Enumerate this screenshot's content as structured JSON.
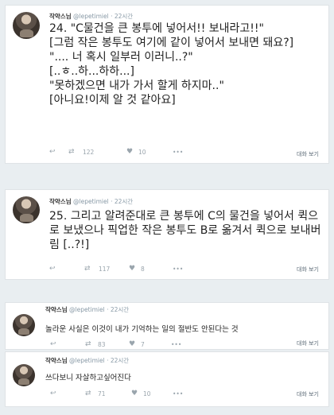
{
  "tweets": [
    {
      "name": "작약스님",
      "handle": "@lepetimiel",
      "time": "· 22시간",
      "lines": [
        "24. \"C물건을 큰 봉투에 넣어서!! 보내라고!!\"",
        "[그럼 작은 봉투도 여기에 같이 넣어서 보내면 돼요?]",
        "\".... 너 혹시 일부러 이러니..?\"",
        "[..ㅎ..하...하하...]",
        "\"못하겠으면 내가 가서 할게 하지마..\"",
        "[아니요!이제 알 것 같아요]"
      ],
      "retweets": "122",
      "likes": "10",
      "conversation": "대화 보기"
    },
    {
      "name": "작약스님",
      "handle": "@lepetimiel",
      "time": "· 22시간",
      "lines": [
        "25. 그리고 알려준대로 큰 봉투에 C의 물건을 넣어서 퀵으로 보냈으나 픽업한 작은 봉투도 B로 옮겨서 퀵으로 보내버림 [..?!]"
      ],
      "retweets": "117",
      "likes": "8",
      "conversation": "대화 보기"
    },
    {
      "name": "작약스님",
      "handle": "@lepetimiel",
      "time": "· 22시간",
      "lines": [
        "놀라운 사실은 이것이 내가 기억하는 일의 절반도 안된다는 것"
      ],
      "retweets": "83",
      "likes": "7",
      "conversation": "대화 보기"
    },
    {
      "name": "작약스님",
      "handle": "@lepetimiel",
      "time": "· 22시간",
      "lines": [
        "쓰다보니 자살하고싶어진다"
      ],
      "retweets": "71",
      "likes": "10",
      "conversation": "대화 보기"
    }
  ],
  "icons": {
    "reply": "reply-icon",
    "retweet": "retweet-icon",
    "like": "heart-icon",
    "more": "more-icon"
  },
  "glyphs": {
    "reply": "↩",
    "retweet": "⇄",
    "like": "♥",
    "more": "•••"
  }
}
